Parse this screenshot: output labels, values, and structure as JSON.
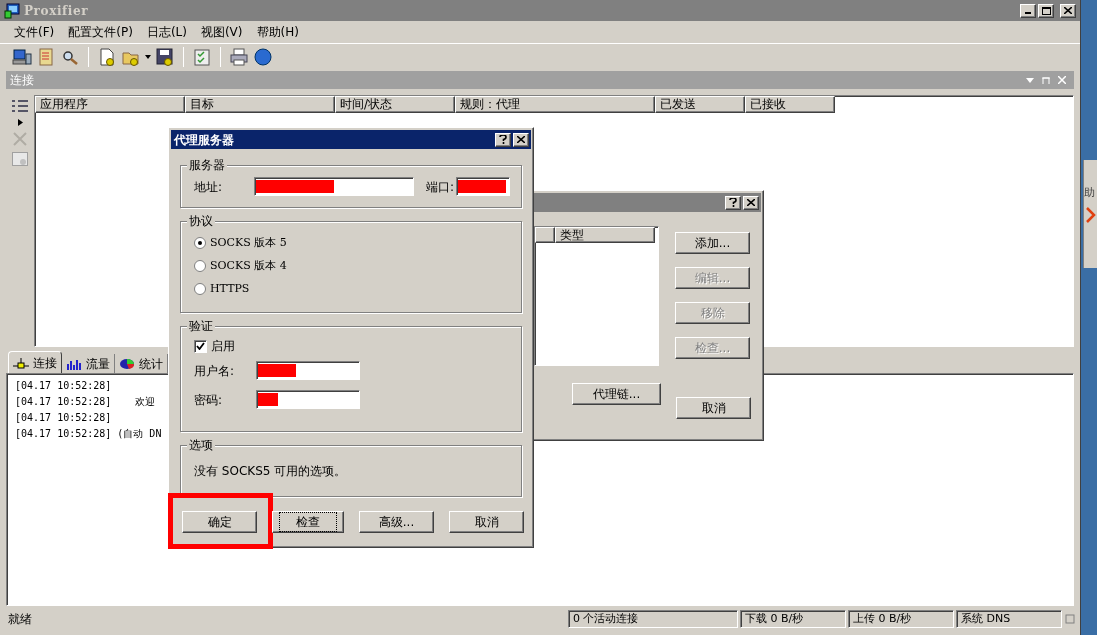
{
  "window": {
    "title": "Proxifier",
    "active": false
  },
  "menu": [
    "文件(F)",
    "配置文件(P)",
    "日志(L)",
    "视图(V)",
    "帮助(H)"
  ],
  "connections_panel": {
    "title": "连接",
    "columns": [
      "应用程序",
      "目标",
      "时间/状态",
      "规则：代理",
      "已发送",
      "已接收"
    ]
  },
  "bottom_tabs": [
    {
      "label": "连接",
      "selected": true
    },
    {
      "label": "流量",
      "selected": false
    },
    {
      "label": "统计",
      "selected": false
    }
  ],
  "log": [
    {
      "time": "[04.17 10:52:28]"
    },
    {
      "time": "[04.17 10:52:28]",
      "message": "欢迎"
    },
    {
      "time": "[04.17 10:52:28]"
    },
    {
      "time": "[04.17 10:52:28]",
      "message": "(自动 DN"
    }
  ],
  "status_bar": [
    "就绪",
    "0 个活动连接",
    "下载 0 B/秒",
    "上传 0 B/秒",
    "系统 DNS"
  ],
  "side_window": {
    "text": "助"
  },
  "proxy_list_dialog": {
    "active": false,
    "columns": [
      "类型"
    ],
    "buttons": [
      {
        "label": "添加...",
        "disabled": false
      },
      {
        "label": "编辑...",
        "disabled": true
      },
      {
        "label": "移除",
        "disabled": true
      },
      {
        "label": "检查...",
        "disabled": true
      }
    ],
    "chain_button": "代理链...",
    "cancel_button": "取消"
  },
  "proxy_dialog": {
    "title": "代理服务器",
    "active": true,
    "server": {
      "legend": "服务器",
      "address_label": "地址:",
      "port_label": "端口:"
    },
    "protocol": {
      "legend": "协议",
      "options": [
        {
          "label": "SOCKS 版本 5",
          "selected": true
        },
        {
          "label": "SOCKS 版本 4",
          "selected": false
        },
        {
          "label": "HTTPS",
          "selected": false
        }
      ]
    },
    "auth": {
      "legend": "验证",
      "enable": {
        "label": "启用",
        "checked": true
      },
      "username_label": "用户名:",
      "password_label": "密码:"
    },
    "options": {
      "legend": "选项",
      "text": "没有 SOCKS5 可用的选项。"
    },
    "buttons": [
      {
        "label": "确定",
        "focused": false,
        "highlighted": true
      },
      {
        "label": "检查",
        "focused": true,
        "highlighted": false
      },
      {
        "label": "高级...",
        "focused": false,
        "highlighted": false
      },
      {
        "label": "取消",
        "focused": false,
        "highlighted": false
      }
    ]
  }
}
